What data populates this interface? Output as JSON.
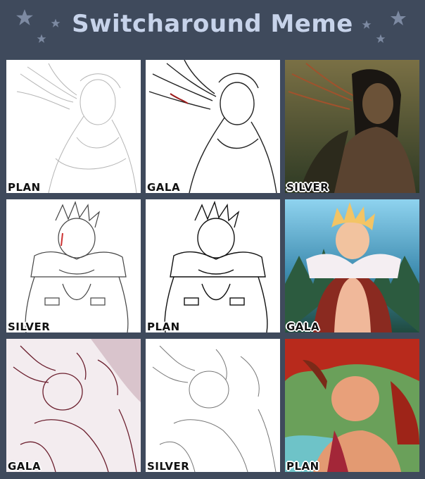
{
  "title": "Switcharound Meme",
  "panels": [
    {
      "label": "PLAN"
    },
    {
      "label": "GALA"
    },
    {
      "label": "SILVER"
    },
    {
      "label": "SILVER"
    },
    {
      "label": "PLAN"
    },
    {
      "label": "GALA"
    },
    {
      "label": "GALA"
    },
    {
      "label": "SILVER"
    },
    {
      "label": "PLAN"
    }
  ],
  "colors": {
    "background": "#3f4a5c",
    "title": "#c7d3ea",
    "stars": "#7d8aa2"
  }
}
